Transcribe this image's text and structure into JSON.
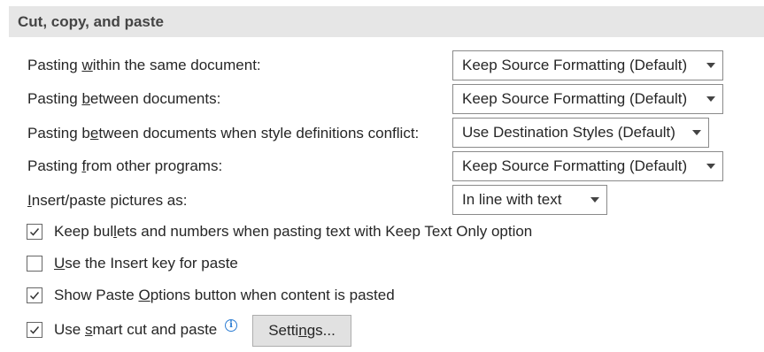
{
  "section": {
    "title": "Cut, copy, and paste"
  },
  "settings": {
    "within_doc": {
      "pre": "Pasting ",
      "key": "w",
      "post": "ithin the same document:",
      "value": "Keep Source Formatting (Default)"
    },
    "between_docs": {
      "pre": "Pasting ",
      "key": "b",
      "post": "etween documents:",
      "value": "Keep Source Formatting (Default)"
    },
    "style_conflict": {
      "pre": "Pasting b",
      "key": "e",
      "post": "tween documents when style definitions conflict:",
      "value": "Use Destination Styles (Default)"
    },
    "other_programs": {
      "pre": "Pasting ",
      "key": "f",
      "post": "rom other programs:",
      "value": "Keep Source Formatting (Default)"
    },
    "pictures": {
      "pre": "",
      "key": "I",
      "post": "nsert/paste pictures as:",
      "value": "In line with text"
    }
  },
  "options": {
    "keep_bullets": {
      "pre": "Keep bul",
      "key": "l",
      "post": "ets and numbers when pasting text with Keep Text Only option",
      "checked": true
    },
    "insert_key": {
      "pre": "",
      "key": "U",
      "post": "se the Insert key for paste",
      "checked": false
    },
    "paste_options": {
      "pre": "Show Paste ",
      "key": "O",
      "post": "ptions button when content is pasted",
      "checked": true
    },
    "smart_cut": {
      "pre": "Use ",
      "key": "s",
      "post": "mart cut and paste",
      "checked": true
    }
  },
  "info_icon": {
    "symbol": "i",
    "icon": "info-icon"
  },
  "settings_button": {
    "pre": "Setti",
    "key": "n",
    "post": "gs..."
  }
}
